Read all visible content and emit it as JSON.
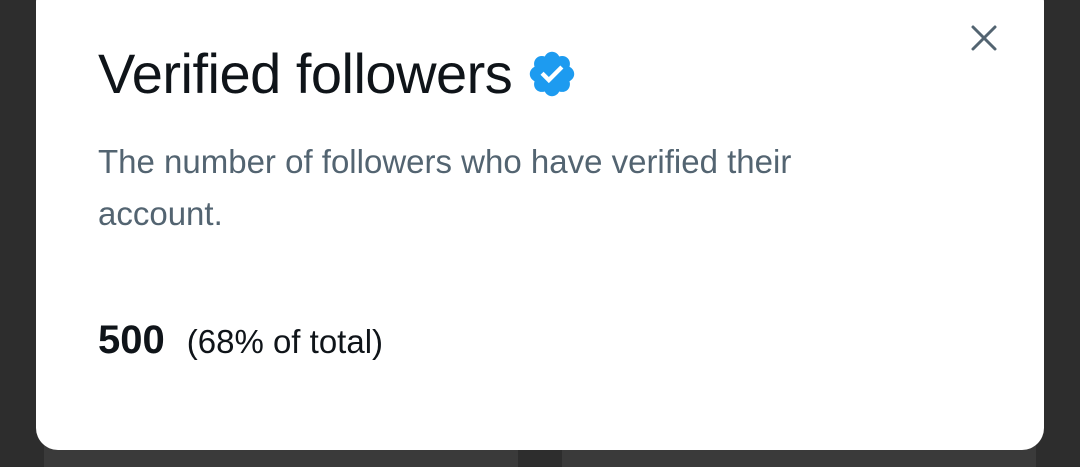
{
  "modal": {
    "title": "Verified followers",
    "title_icon": "verified-badge-icon",
    "description": "The number of followers who have verified their account.",
    "close_icon": "close-icon",
    "stat": {
      "value": "500",
      "percent_label": "(68% of total)"
    }
  },
  "colors": {
    "accent": "#1d9bf0",
    "text_primary": "#0f1419",
    "text_secondary": "#536471",
    "close_icon": "#536471"
  }
}
